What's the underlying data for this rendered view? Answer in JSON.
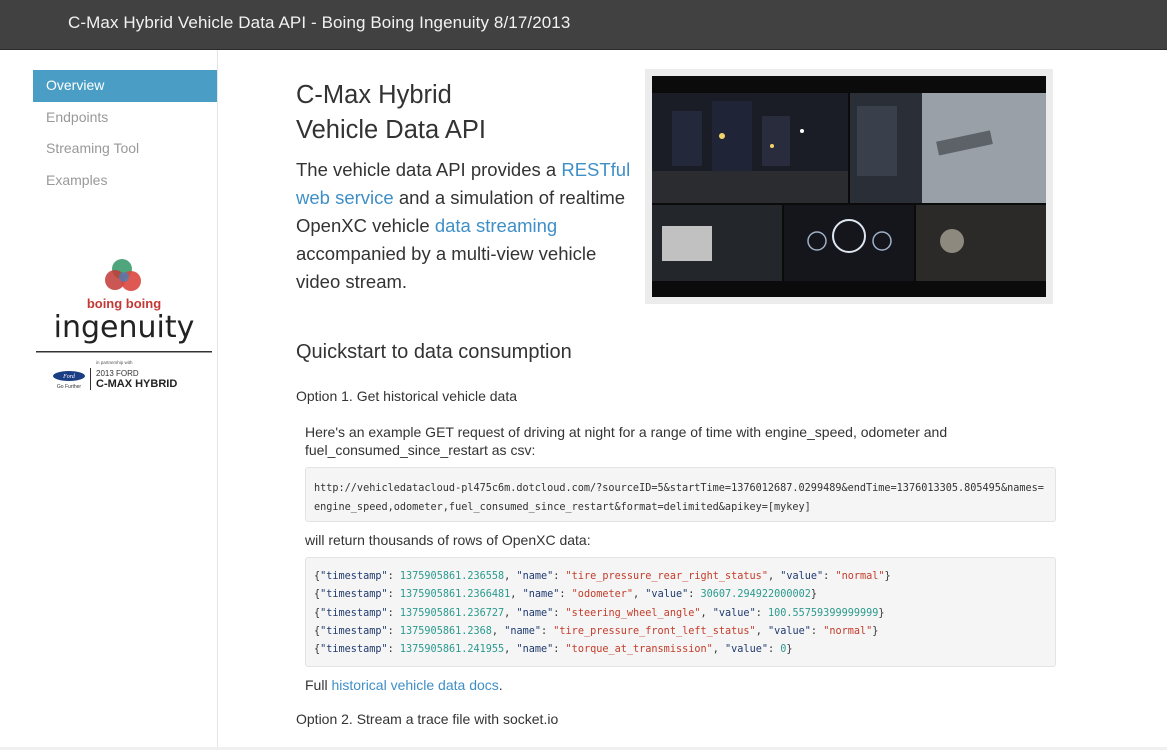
{
  "header": {
    "title": "C-Max Hybrid Vehicle Data API - Boing Boing Ingenuity 8/17/2013"
  },
  "sidebar": {
    "items": [
      {
        "label": "Overview",
        "active": true
      },
      {
        "label": "Endpoints",
        "active": false
      },
      {
        "label": "Streaming Tool",
        "active": false
      },
      {
        "label": "Examples",
        "active": false
      }
    ],
    "logo": {
      "brand_top": "boing boing",
      "brand_main": "ingenuity",
      "partnership": "in partnership with",
      "ford": "Ford",
      "go_further": "Go Further",
      "model_year": "2013 FORD",
      "model": "C-MAX HYBRID"
    }
  },
  "main": {
    "title_line1": "C-Max Hybrid",
    "title_line2": "Vehicle Data API",
    "intro": {
      "t1": "The vehicle data API provides a ",
      "link1": "RESTful web service",
      "t2": " and a simulation of realtime OpenXC vehicle ",
      "link2": "data streaming",
      "t3": " accompanied by a multi-view vehicle video stream."
    },
    "quickstart_heading": "Quickstart to data consumption",
    "option1": {
      "heading": "Option 1. Get historical vehicle data",
      "description": "Here's an example GET request of driving at night for a range of time with engine_speed, odometer and fuel_consumed_since_restart as csv:",
      "url": "http://vehicledatacloud-pl475c6m.dotcloud.com/?sourceID=5&startTime=1376012687.0299489&endTime=1376013305.805495&names=engine_speed,odometer,fuel_consumed_since_restart&format=delimited&apikey=[mykey]",
      "returns_text": "will return thousands of rows of OpenXC data:",
      "records": [
        {
          "timestamp": "1375905861.236558",
          "name": "tire_pressure_rear_right_status",
          "value": "normal",
          "value_is_string": true
        },
        {
          "timestamp": "1375905861.2366481",
          "name": "odometer",
          "value": "30607.294922000002",
          "value_is_string": false
        },
        {
          "timestamp": "1375905861.236727",
          "name": "steering_wheel_angle",
          "value": "100.55759399999999",
          "value_is_string": false
        },
        {
          "timestamp": "1375905861.2368",
          "name": "tire_pressure_front_left_status",
          "value": "normal",
          "value_is_string": true
        },
        {
          "timestamp": "1375905861.241955",
          "name": "torque_at_transmission",
          "value": "0",
          "value_is_string": false
        }
      ],
      "docs_prefix": "Full ",
      "docs_link": "historical vehicle data docs",
      "docs_suffix": "."
    },
    "option2": {
      "heading": "Option 2. Stream a trace file with socket.io"
    }
  },
  "colors": {
    "accent": "#4a9ec6",
    "link": "#3f8fc7",
    "header_bg": "#414141"
  }
}
